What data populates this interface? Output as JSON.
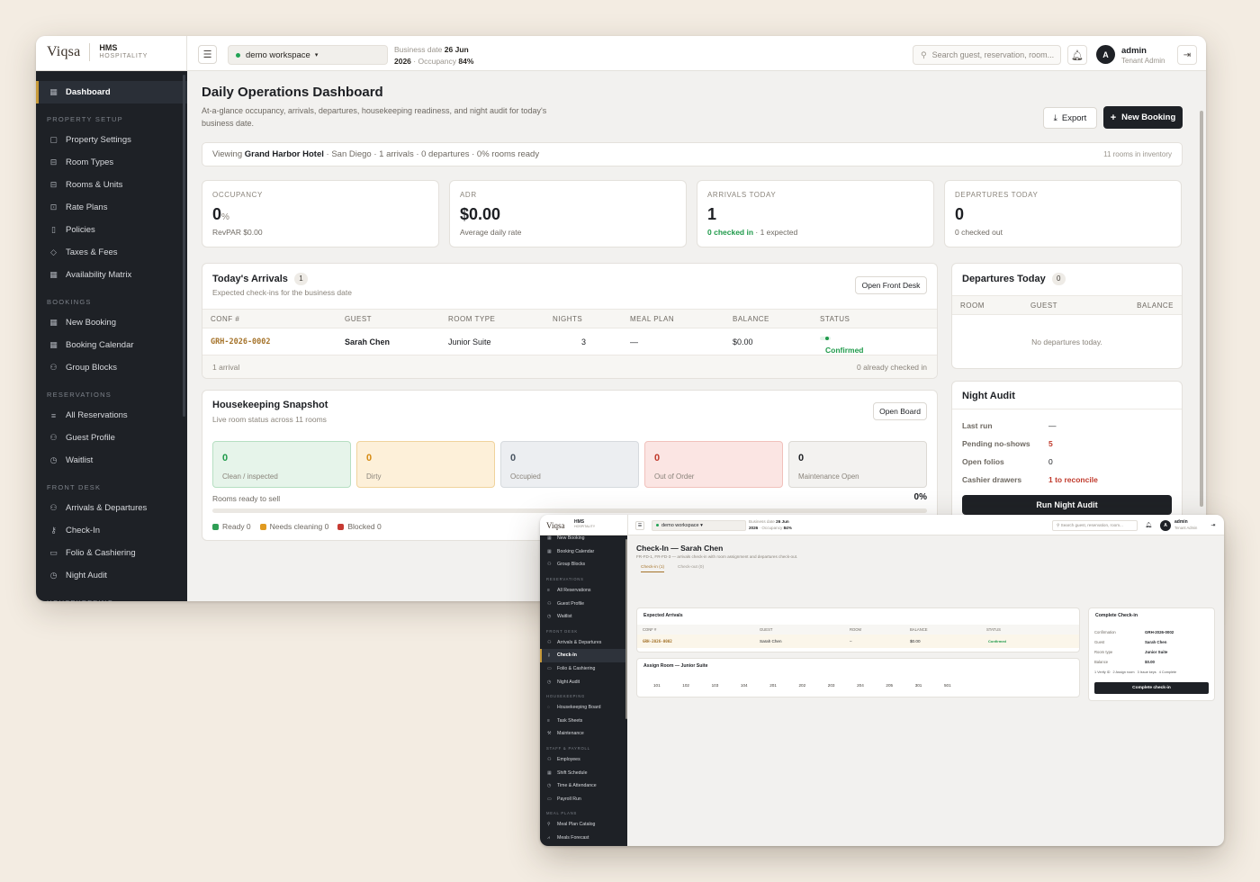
{
  "app": {
    "logo_mark": "Viqsa",
    "logo_line1": "HMS",
    "logo_line2": "HOSPITALITY",
    "menu_icon": "hamburger-icon",
    "workspace": "demo workspace",
    "business_date_label": "Business date",
    "business_date_value": "26 Jun",
    "business_year": "2026",
    "occupancy_label": "Occupancy",
    "occupancy_value": "84%",
    "search_placeholder": "Search guest, reservation, room...",
    "user_initial": "A",
    "user_name": "admin",
    "user_role": "Tenant Admin"
  },
  "sidebar": {
    "active": "Dashboard",
    "sections": [
      {
        "heading": "PROPERTY SETUP",
        "items": [
          "Property Settings",
          "Room Types",
          "Rooms & Units",
          "Rate Plans",
          "Policies",
          "Taxes & Fees",
          "Availability Matrix"
        ]
      },
      {
        "heading": "BOOKINGS",
        "items": [
          "New Booking",
          "Booking Calendar",
          "Group Blocks"
        ]
      },
      {
        "heading": "RESERVATIONS",
        "items": [
          "All Reservations",
          "Guest Profile",
          "Waitlist"
        ]
      },
      {
        "heading": "FRONT DESK",
        "items": [
          "Arrivals & Departures",
          "Check-In",
          "Folio & Cashiering",
          "Night Audit"
        ]
      },
      {
        "heading": "HOUSEKEEPING",
        "items": []
      }
    ]
  },
  "dashboard": {
    "title": "Daily Operations Dashboard",
    "subtitle": "At-a-glance occupancy, arrivals, departures, housekeeping readiness, and night audit for today's business date.",
    "export_label": "Export",
    "new_booking_label": "New Booking",
    "viewing_prefix": "Viewing",
    "hotel_name": "Grand Harbor Hotel",
    "viewing_rest": "· San Diego · 1 arrivals · 0 departures · 0% rooms ready",
    "inventory": "11 rooms in inventory",
    "kpis": {
      "occupancy": {
        "label": "OCCUPANCY",
        "value": "0",
        "unit": "%",
        "sub": "RevPAR $0.00"
      },
      "adr": {
        "label": "ADR",
        "value": "$0.00",
        "sub": "Average daily rate"
      },
      "arrivals": {
        "label": "ARRIVALS TODAY",
        "value": "1",
        "sub_green": "0 checked in",
        "sub_rest": "· 1 expected"
      },
      "departures": {
        "label": "DEPARTURES TODAY",
        "value": "0",
        "sub": "0 checked out"
      }
    },
    "arrivals": {
      "title": "Today's Arrivals",
      "count": "1",
      "subtitle": "Expected check-ins for the business date",
      "button": "Open Front Desk",
      "columns": [
        "CONF #",
        "GUEST",
        "ROOM TYPE",
        "NIGHTS",
        "MEAL PLAN",
        "BALANCE",
        "STATUS"
      ],
      "rows": [
        {
          "conf": "GRH-2026-0002",
          "guest": "Sarah Chen",
          "room_type": "Junior Suite",
          "nights": "3",
          "meal_plan": "—",
          "balance": "$0.00",
          "status": "Confirmed"
        }
      ],
      "footer_left": "1 arrival",
      "footer_right": "0 already checked in"
    },
    "departures": {
      "title": "Departures Today",
      "count": "0",
      "columns": [
        "ROOM",
        "GUEST",
        "BALANCE"
      ],
      "empty": "No departures today."
    },
    "housekeeping": {
      "title": "Housekeeping Snapshot",
      "subtitle": "Live room status across 11 rooms",
      "button": "Open Board",
      "tiles": [
        {
          "value": "0",
          "label": "Clean / inspected",
          "bg": "#e6f4ea",
          "border": "#b6dfc2",
          "color": "#1f9a4a"
        },
        {
          "value": "0",
          "label": "Dirty",
          "bg": "#fdf0d9",
          "border": "#f0d39c",
          "color": "#d68a12"
        },
        {
          "value": "0",
          "label": "Occupied",
          "bg": "#eceef1",
          "border": "#d6dade",
          "color": "#4a5663"
        },
        {
          "value": "0",
          "label": "Out of Order",
          "bg": "#fbe5e3",
          "border": "#f1c1bc",
          "color": "#c0392b"
        },
        {
          "value": "0",
          "label": "Maintenance Open",
          "bg": "#f3f2f0",
          "border": "#dcd9d4",
          "color": "#1d1f23"
        }
      ],
      "progress_label": "Rooms ready to sell",
      "progress_value": "0%",
      "progress_fraction": 0,
      "legend": [
        {
          "label": "Ready 0",
          "color": "#2e9e55"
        },
        {
          "label": "Needs cleaning 0",
          "color": "#e09a20"
        },
        {
          "label": "Blocked 0",
          "color": "#c63a32"
        }
      ]
    },
    "night_audit": {
      "title": "Night Audit",
      "rows": [
        {
          "k": "Last run",
          "v": "—"
        },
        {
          "k": "Pending no-shows",
          "v": "5",
          "red": true
        },
        {
          "k": "Open folios",
          "v": "0"
        },
        {
          "k": "Cashier drawers",
          "v": "1 to reconcile",
          "red": true
        }
      ],
      "button": "Run Night Audit"
    }
  },
  "checkin_window": {
    "sidebar_top_items": [
      "New Booking",
      "Booking Calendar",
      "Group Blocks"
    ],
    "sidebar_sections": [
      {
        "heading": "RESERVATIONS",
        "items": [
          "All Reservations",
          "Guest Profile",
          "Waitlist"
        ]
      },
      {
        "heading": "FRONT DESK",
        "items": [
          "Arrivals & Departures",
          "Check-In",
          "Folio & Cashiering",
          "Night Audit"
        ]
      },
      {
        "heading": "HOUSEKEEPING",
        "items": [
          "Housekeeping Board",
          "Task Sheets",
          "Maintenance"
        ]
      },
      {
        "heading": "STAFF & PAYROLL",
        "items": [
          "Employees",
          "Shift Schedule",
          "Time & Attendance",
          "Payroll Run"
        ]
      },
      {
        "heading": "MEAL PLANS",
        "items": [
          "Meal Plan Catalog",
          "Meals Forecast"
        ]
      }
    ],
    "active": "Check-In",
    "title": "Check-In — Sarah Chen",
    "subtitle": "FR-FD-1, FR-FD-3 — arrivals check-in with room assignment and departures check-out.",
    "tabs": [
      "Check-in (1)",
      "Check-out (0)"
    ],
    "expected_title": "Expected Arrivals",
    "expected_columns": [
      "CONF #",
      "GUEST",
      "ROOM",
      "BALANCE",
      "STATUS"
    ],
    "expected_row": {
      "conf": "GRH-2026-0002",
      "guest": "Sarah Chen",
      "room": "–",
      "balance": "$0.00",
      "status": "Confirmed"
    },
    "assign_title": "Assign Room — Junior Suite",
    "rooms": [
      "101",
      "102",
      "103",
      "104",
      "201",
      "202",
      "203",
      "204",
      "205",
      "301",
      "501"
    ],
    "complete_title": "Complete Check-in",
    "complete_rows": [
      {
        "k": "Confirmation",
        "v": "GRH-2026-0002"
      },
      {
        "k": "Guest",
        "v": "Sarah Chen"
      },
      {
        "k": "Room type",
        "v": "Junior Suite"
      },
      {
        "k": "Balance",
        "v": "$0.00"
      }
    ],
    "steps": [
      "1 Verify ID",
      "2 Assign room",
      "3 Issue keys",
      "4 Complete"
    ],
    "complete_button": "Complete check-in"
  }
}
